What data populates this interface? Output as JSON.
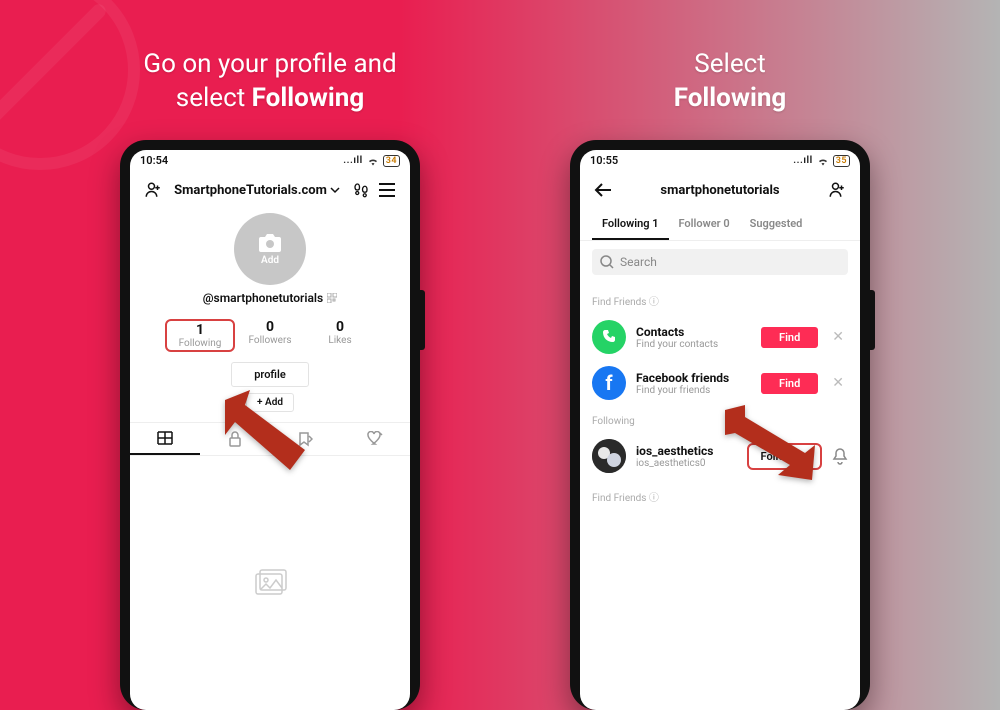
{
  "captions": {
    "left_line1": "Go on your profile and",
    "left_line2_prefix": "select ",
    "left_line2_bold": "Following",
    "right_line1": "Select",
    "right_line2_bold": "Following"
  },
  "phone1": {
    "time": "10:54",
    "signal_text": "...ıll",
    "battery": "34",
    "title": "SmartphoneTutorials.com",
    "avatar_label": "Add",
    "handle": "@smartphonetutorials",
    "stats": {
      "following_num": "1",
      "following_lbl": "Following",
      "followers_num": "0",
      "followers_lbl": "Followers",
      "likes_num": "0",
      "likes_lbl": "Likes"
    },
    "edit_profile_btn": "profile",
    "add_bio_btn": "+ Add"
  },
  "phone2": {
    "time": "10:55",
    "signal_text": "...ıll",
    "battery": "35",
    "title": "smartphonetutorials",
    "tabs": {
      "following": "Following 1",
      "followers": "Follower 0",
      "suggested": "Suggested"
    },
    "search_placeholder": "Search",
    "find_friends_label": "Find Friends ⓘ",
    "contacts": {
      "title": "Contacts",
      "subtitle": "Find your contacts",
      "button": "Find"
    },
    "facebook": {
      "title": "Facebook friends",
      "subtitle": "Find your friends",
      "button": "Find"
    },
    "following_label": "Following",
    "user": {
      "name": "ios_aesthetics",
      "handle": "ios_aesthetics0",
      "button": "Following"
    },
    "find_friends2_label": "Find Friends ⓘ"
  }
}
